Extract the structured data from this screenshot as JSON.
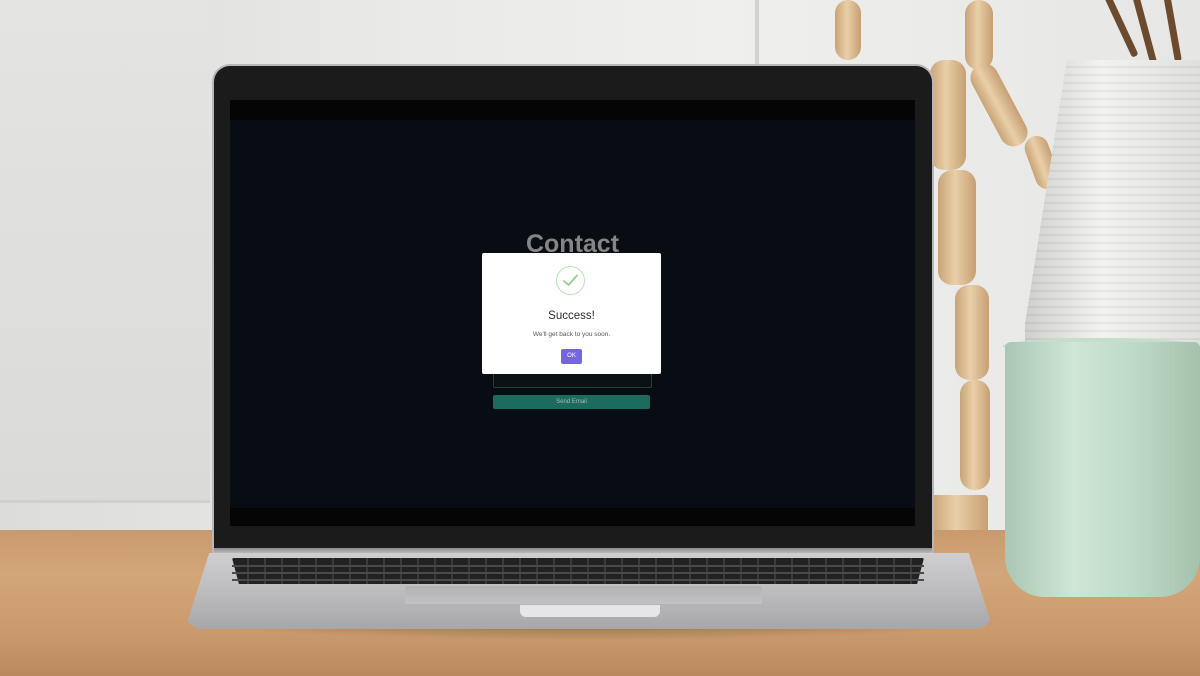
{
  "page": {
    "title": "Contact",
    "send_button_label": "Send Email"
  },
  "modal": {
    "icon": "checkmark-circle-icon",
    "title": "Success!",
    "message": "We'll get back to you soon.",
    "ok_label": "OK",
    "accent_color": "#7266e6",
    "success_color": "#8fd18a"
  },
  "colors": {
    "screen_background": "#0a0e16",
    "send_button": "#1f7a6c"
  }
}
